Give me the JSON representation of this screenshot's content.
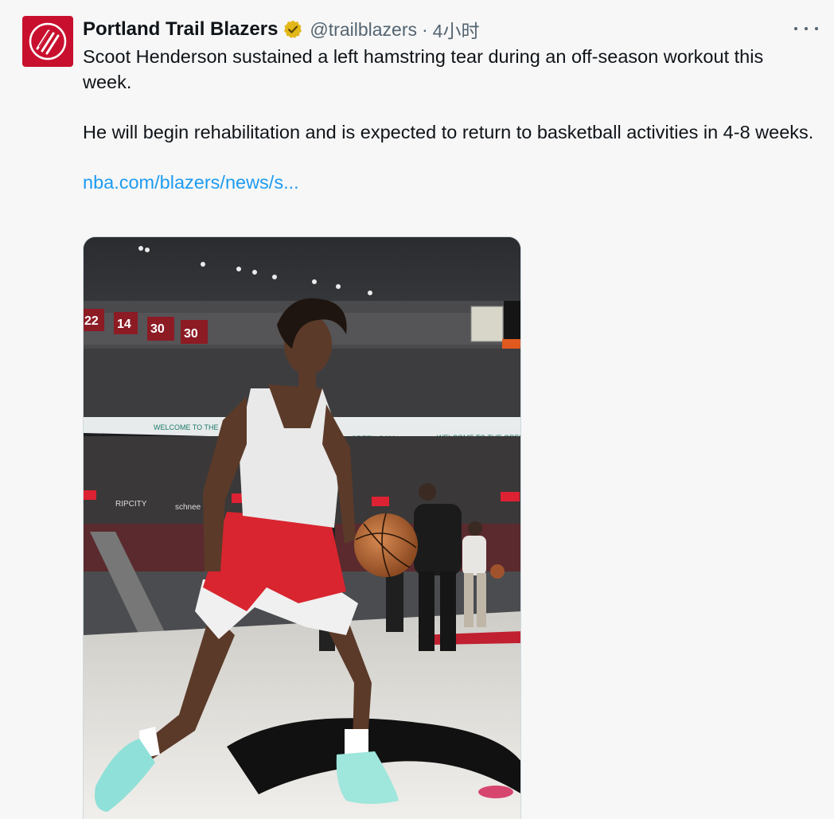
{
  "author": {
    "display_name": "Portland Trail Blazers",
    "handle": "@trailblazers",
    "separator": "·",
    "time_ago": "4小时",
    "verified_color": "#e2b719",
    "avatar_color": "#c8102e"
  },
  "tweet": {
    "paragraph_1": "Scoot Henderson sustained a left hamstring tear during an off-season workout this week.",
    "paragraph_2": "He will begin rehabilitation and is expected to return to basketball activities in 4-8 weeks.",
    "link_text": "nba.com/blazers/news/s..."
  },
  "media": {
    "banner_text": "WELCOME TO THE GREEN GAM",
    "banner_text_2": "WELCOME TO THE",
    "banner_text_3": "GREEN GAM",
    "retired_numbers": [
      "22",
      "14",
      "30",
      "30"
    ],
    "ripcity_sign": "RIPCITY",
    "sign_text": "schnee",
    "jersey_color": "#d9252f"
  },
  "colors": {
    "link": "#1d9bf0",
    "secondary_text": "#536471",
    "primary_text": "#0f1419"
  }
}
